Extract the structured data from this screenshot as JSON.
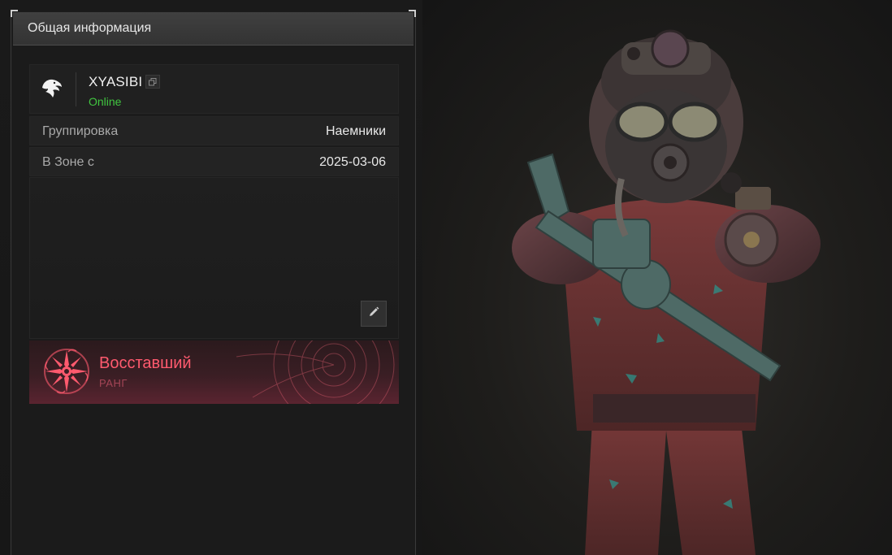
{
  "panel": {
    "title": "Общая информация"
  },
  "profile": {
    "name": "XYASIBI",
    "status": "Online",
    "status_color": "#41c640",
    "faction_icon": "eagle-icon",
    "copy_icon": "copy-icon"
  },
  "info": {
    "faction_label": "Группировка",
    "faction_value": "Наемники",
    "zone_label": "В Зоне с",
    "zone_value": "2025-03-06"
  },
  "bio": {
    "edit_icon": "pencil-icon"
  },
  "rank": {
    "title": "Восставший",
    "subtitle": "РАНГ",
    "color": "#ff5a6e",
    "emblem_icon": "rank-emblem-icon"
  },
  "colors": {
    "panel_bg": "#1b1b1b",
    "header_bg": "#3a3a3a",
    "online": "#41c640",
    "rank_accent": "#ff5a6e"
  }
}
